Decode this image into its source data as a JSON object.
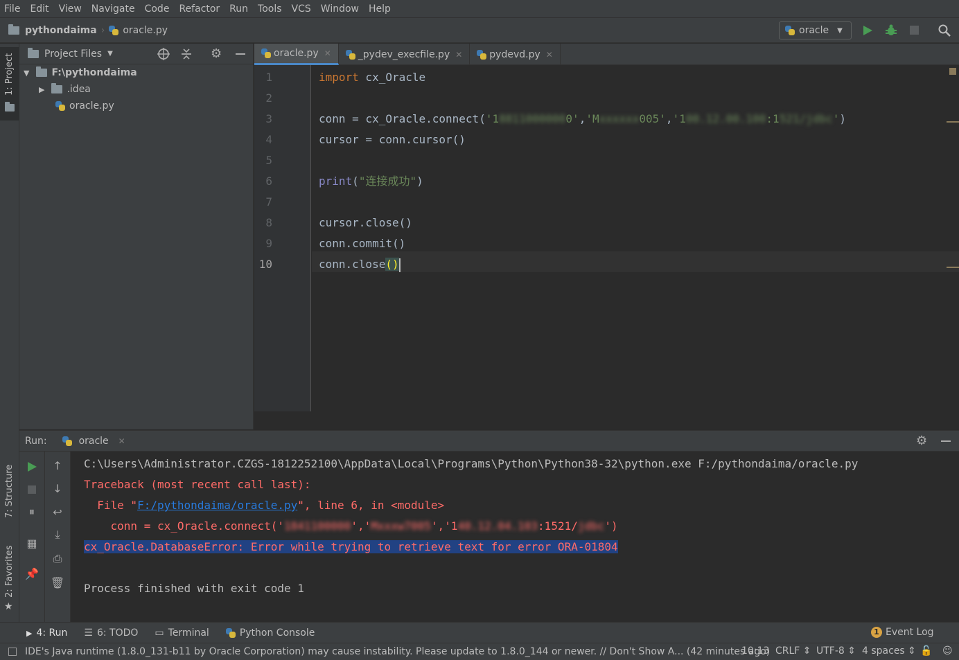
{
  "menu": [
    "File",
    "Edit",
    "View",
    "Navigate",
    "Code",
    "Refactor",
    "Run",
    "Tools",
    "VCS",
    "Window",
    "Help"
  ],
  "breadcrumb": {
    "project": "pythondaima",
    "file": "oracle.py"
  },
  "run_config": "oracle",
  "left_strip": {
    "project": "1: Project",
    "structure": "7: Structure",
    "favorites": "2: Favorites"
  },
  "project_panel": {
    "header": "Project Files",
    "root": "F:\\pythondaima",
    "items": [
      ".idea",
      "oracle.py"
    ]
  },
  "tabs": [
    "oracle.py",
    "_pydev_execfile.py",
    "pydevd.py"
  ],
  "line_numbers": [
    "1",
    "2",
    "3",
    "4",
    "5",
    "6",
    "7",
    "8",
    "9",
    "10"
  ],
  "code": {
    "l1_kw": "import",
    "l1_rest": " cx_Oracle",
    "l3_a": "conn = cx_Oracle.connect(",
    "l3_s1": "'1",
    "l3_s1_blur": "8811000000",
    "l3_s1_end": "0'",
    "l3_sep1": ",",
    "l3_s2": "'M",
    "l3_s2_blur": "xxxxxx",
    "l3_s2_end": "005'",
    "l3_sep2": ",",
    "l3_s3": "'1",
    "l3_s3_blur": "00.12.00.100",
    "l3_s3_mid": ":1",
    "l3_s3_blur2": "521/jdbc",
    "l3_s3_end": "'",
    "l3_close": ")",
    "l4": "cursor = conn.cursor()",
    "l6_bi": "print",
    "l6_open": "(",
    "l6_str": "\"连接成功\"",
    "l6_close": ")",
    "l8": "cursor.close()",
    "l9": "conn.commit()",
    "l10_a": "conn.close",
    "l10_paren": "()"
  },
  "run_panel": {
    "label": "Run:",
    "tab": "oracle",
    "line1": "C:\\Users\\Administrator.CZGS-1812252100\\AppData\\Local\\Programs\\Python\\Python38-32\\python.exe F:/pythondaima/oracle.py",
    "line2": "Traceback (most recent call last):",
    "line3_a": "  File \"",
    "line3_link": "F:/pythondaima/oracle.py",
    "line3_b": "\", line 6, in <module>",
    "line4_a": "    conn = cx_Oracle.connect('",
    "line4_blur": "1841100000",
    "line4_b": "','",
    "line4_blur2": "Mxxxw7005",
    "line4_c": "','1",
    "line4_blur3": "40.12.04.103",
    "line4_d": ":1521/",
    "line4_blur4": "jdbc",
    "line4_e": "')",
    "line5": "cx_Oracle.DatabaseError: Error while trying to retrieve text for error ORA-01804",
    "line7": "Process finished with exit code 1"
  },
  "bottom_tabs": [
    "4: Run",
    "6: TODO",
    "Terminal",
    "Python Console"
  ],
  "event_log": {
    "count": "1",
    "label": "Event Log"
  },
  "status": {
    "message": "IDE's Java runtime (1.8.0_131-b11 by Oracle Corporation) may cause instability. Please update to 1.8.0_144 or newer. // Don't Show A... (42 minutes ago)",
    "position": "10:13",
    "line_sep": "CRLF",
    "encoding": "UTF-8",
    "indent": "4 spaces"
  },
  "colors": {
    "background": "#2b2b2b",
    "panel": "#3c3f41",
    "keyword": "#cc7832",
    "string": "#6a8759",
    "error": "#ff6b68",
    "selection": "#214283"
  }
}
